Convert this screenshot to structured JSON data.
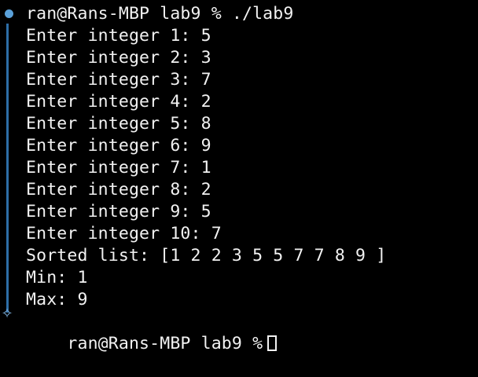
{
  "terminal": {
    "prompt": "ran@Rans-MBP lab9 % ./lab9",
    "output": [
      "Enter integer 1: 5",
      "Enter integer 2: 3",
      "Enter integer 3: 7",
      "Enter integer 4: 2",
      "Enter integer 5: 8",
      "Enter integer 6: 9",
      "Enter integer 7: 1",
      "Enter integer 8: 2",
      "Enter integer 9: 5",
      "Enter integer 10: 7",
      "Sorted list: [1 2 2 3 5 5 7 7 8 9 ]",
      "Min: 1",
      "Max: 9"
    ],
    "next_prompt": "ran@Rans-MBP lab9 %",
    "markers": {
      "command_dot_color": "#5aa0d8",
      "bracket_color": "#2d6ea7",
      "bottom_marker_icon": "sparkle-star-icon"
    }
  }
}
